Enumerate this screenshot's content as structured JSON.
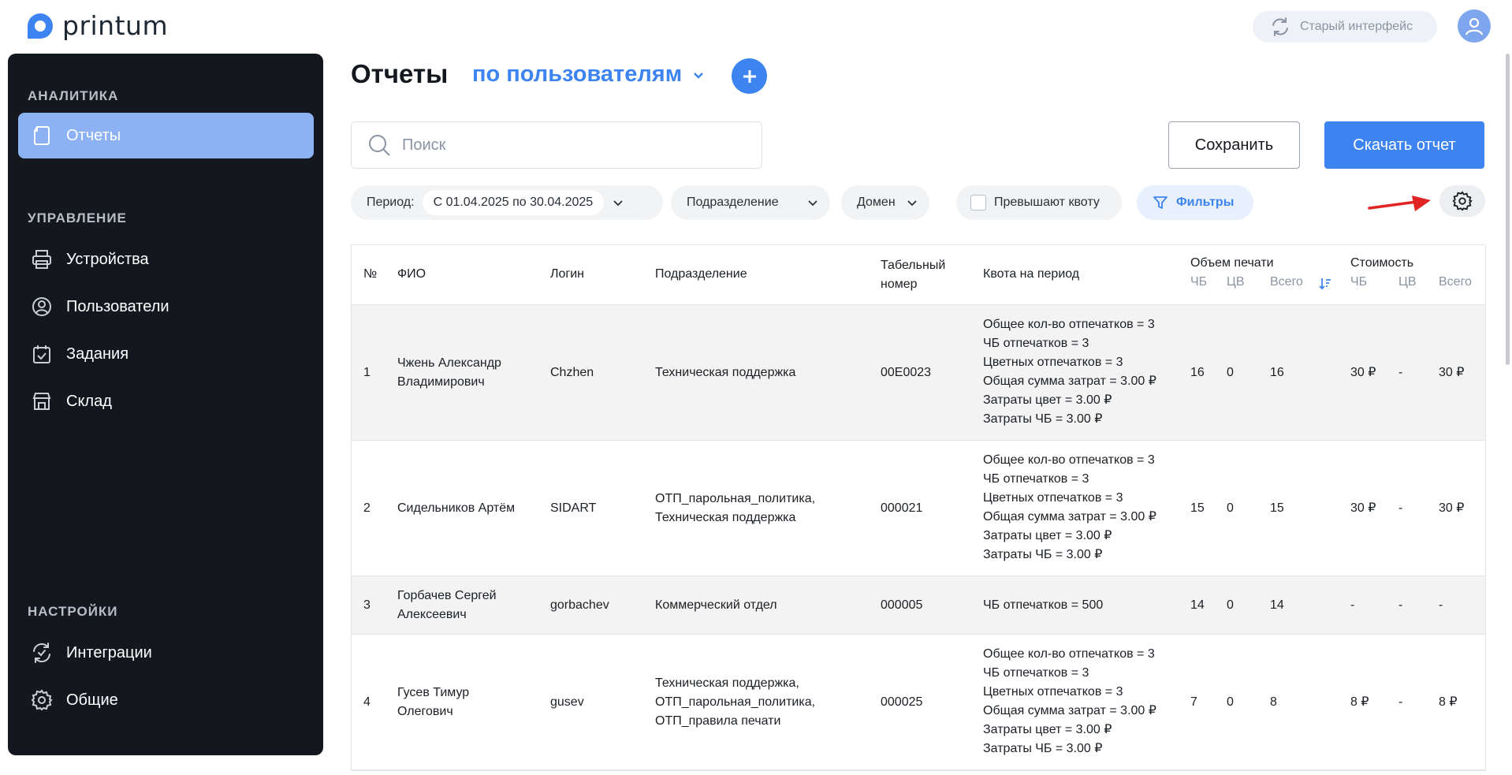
{
  "app": {
    "logo_text": "printum",
    "old_ui_label": "Старый интерфейс"
  },
  "sidebar": {
    "sections": [
      {
        "title": "АНАЛИТИКА",
        "items": [
          {
            "label": "Отчеты",
            "icon": "reports-icon",
            "active": true
          }
        ]
      },
      {
        "title": "УПРАВЛЕНИЕ",
        "items": [
          {
            "label": "Устройства",
            "icon": "printer-icon"
          },
          {
            "label": "Пользователи",
            "icon": "user-icon"
          },
          {
            "label": "Задания",
            "icon": "calendar-check-icon"
          },
          {
            "label": "Склад",
            "icon": "store-icon"
          }
        ]
      },
      {
        "title": "НАСТРОЙКИ",
        "items": [
          {
            "label": "Интеграции",
            "icon": "sync-icon"
          },
          {
            "label": "Общие",
            "icon": "gear-icon"
          }
        ]
      }
    ]
  },
  "header": {
    "title": "Отчеты",
    "report_type": "по пользователям"
  },
  "search": {
    "placeholder": "Поиск",
    "value": ""
  },
  "actions": {
    "save": "Сохранить",
    "download": "Скачать отчет"
  },
  "filters": {
    "period_label": "Период:",
    "period_value": "С 01.04.2025 по 30.04.2025",
    "department": "Подразделение",
    "domain": "Домен",
    "exceed_quota": "Превышают квоту",
    "filters_button": "Фильтры"
  },
  "table": {
    "headers": {
      "num": "№",
      "fio": "ФИО",
      "login": "Логин",
      "department": "Подразделение",
      "tab_number": [
        "Табельный",
        "номер"
      ],
      "quota": "Квота на период",
      "volume": "Объем печати",
      "cost": "Стоимость",
      "bw": "ЧБ",
      "color": "ЦВ",
      "total": "Всего"
    },
    "rows": [
      {
        "num": "1",
        "fio": [
          "Чжень Александр",
          "Владимирович"
        ],
        "login": "Chzhen",
        "department": [
          "Техническая поддержка"
        ],
        "tab": "00E0023",
        "quota": [
          "Общее кол-во отпечатков = 3",
          "ЧБ отпечатков = 3",
          "Цветных отпечатков = 3",
          "Общая сумма затрат = 3.00 ₽",
          "Затраты цвет = 3.00 ₽",
          "Затраты ЧБ = 3.00 ₽"
        ],
        "vol_bw": "16",
        "vol_color": "0",
        "vol_total": "16",
        "cost_bw": "30 ₽",
        "cost_color": "-",
        "cost_total": "30 ₽"
      },
      {
        "num": "2",
        "fio": [
          "Сидельников Артём"
        ],
        "login": "SIDART",
        "department": [
          "ОТП_парольная_политика,",
          "Техническая поддержка"
        ],
        "tab": "000021",
        "quota": [
          "Общее кол-во отпечатков = 3",
          "ЧБ отпечатков = 3",
          "Цветных отпечатков = 3",
          "Общая сумма затрат = 3.00 ₽",
          "Затраты цвет = 3.00 ₽",
          "Затраты ЧБ = 3.00 ₽"
        ],
        "vol_bw": "15",
        "vol_color": "0",
        "vol_total": "15",
        "cost_bw": "30 ₽",
        "cost_color": "-",
        "cost_total": "30 ₽"
      },
      {
        "num": "3",
        "fio": [
          "Горбачев Сергей",
          "Алексеевич"
        ],
        "login": "gorbachev",
        "department": [
          "Коммерческий отдел"
        ],
        "tab": "000005",
        "quota": [
          "ЧБ отпечатков = 500"
        ],
        "vol_bw": "14",
        "vol_color": "0",
        "vol_total": "14",
        "cost_bw": "-",
        "cost_color": "-",
        "cost_total": "-"
      },
      {
        "num": "4",
        "fio": [
          "Гусев Тимур",
          "Олегович"
        ],
        "login": "gusev",
        "department": [
          "Техническая поддержка,",
          "ОТП_парольная_политика,",
          "ОТП_правила печати"
        ],
        "tab": "000025",
        "quota": [
          "Общее кол-во отпечатков = 3",
          "ЧБ отпечатков = 3",
          "Цветных отпечатков = 3",
          "Общая сумма затрат = 3.00 ₽",
          "Затраты цвет = 3.00 ₽",
          "Затраты ЧБ = 3.00 ₽"
        ],
        "vol_bw": "7",
        "vol_color": "0",
        "vol_total": "8",
        "cost_bw": "8 ₽",
        "cost_color": "-",
        "cost_total": "8 ₽"
      }
    ]
  },
  "colors": {
    "accent": "#3d84f0",
    "sidebar_bg": "#14181e",
    "active_item": "#8cb2f4",
    "annotation_arrow": "#e02424"
  }
}
